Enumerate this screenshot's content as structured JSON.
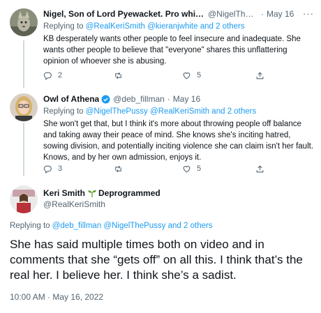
{
  "tweets": [
    {
      "name": "Nigel, Son of Lord Pyewacket. Pro whiff-t...",
      "handle": "@NigelThePussy",
      "date": "May 16",
      "replying_prefix": "Replying to ",
      "replying_links": "@RealKeriSmith @kieranjwhite and 2 others",
      "text": "KB desperately wants other people to feel insecure and inadequate.  She wants other people to believe that \"everyone\" shares this unflattering opinion of whoever she is abusing.",
      "replies": "2",
      "retweets": "",
      "likes": "5"
    },
    {
      "name": "Owl of Athena",
      "handle": "@deb_fillman",
      "date": "May 16",
      "replying_prefix": "Replying to ",
      "replying_links": "@NigelThePussy @RealKeriSmith and 2 others",
      "text": "She won't get that, but I think it's more about throwing people off balance and taking away their peace of mind. She knows she's inciting hatred, sowing division, and potentially inciting violence she can claim isn't her fault. Knows, and by her own admission, enjoys it.",
      "replies": "3",
      "retweets": "",
      "likes": "5"
    }
  ],
  "main_tweet": {
    "name": "Keri Smith",
    "name_suffix": "Deprogrammed",
    "handle": "@RealKeriSmith",
    "replying_prefix": "Replying to ",
    "replying_links": "@deb_fillman @NigelThePussy and 2 others",
    "text": "She has said multiple times both on video and in comments that she “gets off” on all this. I think that’s the real her. I believe her. I think she’s a sadist.",
    "timestamp": "10:00 AM · May 16, 2022"
  },
  "ui": {
    "more": "···",
    "dot": "·"
  },
  "colors": {
    "link": "#1d9bf0",
    "secondary": "#536471",
    "verified": "#1d9bf0",
    "thread_line": "#cfd9de"
  },
  "icons": [
    "reply-icon",
    "retweet-icon",
    "like-icon",
    "share-icon",
    "verified-badge-icon",
    "sprout-icon",
    "more-icon"
  ]
}
